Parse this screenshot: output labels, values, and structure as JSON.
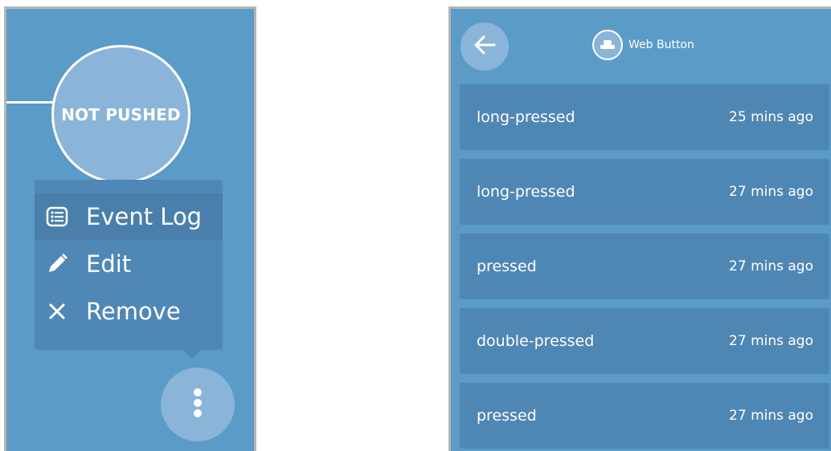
{
  "left": {
    "state_label": "NOT PUSHED",
    "menu": {
      "items": [
        {
          "label": "Event Log",
          "icon": "list-icon",
          "active": true
        },
        {
          "label": "Edit",
          "icon": "pencil-icon",
          "active": false
        },
        {
          "label": "Remove",
          "icon": "close-icon",
          "active": false
        }
      ]
    },
    "fab_icon": "more-vertical-icon"
  },
  "right": {
    "back_icon": "arrow-left-icon",
    "device": {
      "title": "Web Button",
      "icon": "button-icon"
    },
    "events": [
      {
        "name": "long-pressed",
        "time": "25 mins ago"
      },
      {
        "name": "long-pressed",
        "time": "27 mins ago"
      },
      {
        "name": "pressed",
        "time": "27 mins ago"
      },
      {
        "name": "double-pressed",
        "time": "27 mins ago"
      },
      {
        "name": "pressed",
        "time": "27 mins ago"
      }
    ]
  },
  "colors": {
    "panel_bg": "#5b9bc8",
    "menu_bg": "#4f88b6",
    "row_bg": "#4f87b4",
    "circle_bg": "#8ab5d8"
  }
}
